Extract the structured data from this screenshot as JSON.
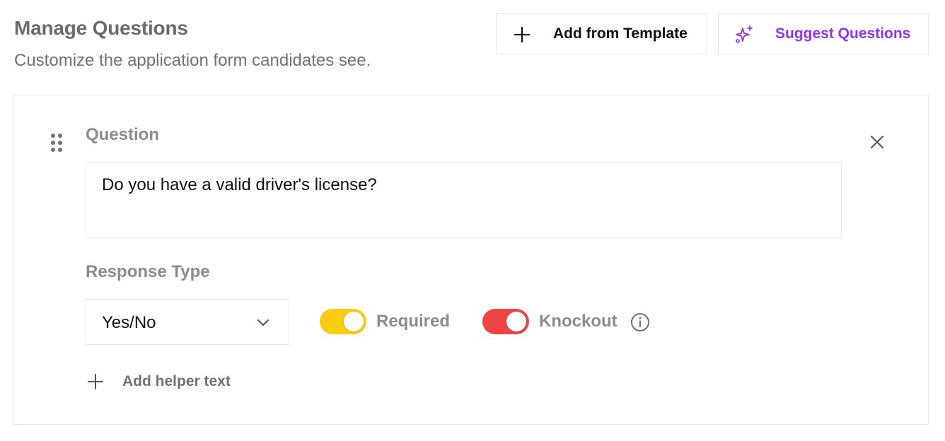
{
  "header": {
    "title": "Manage Questions",
    "subtitle": "Customize the application form candidates see."
  },
  "actions": {
    "add_from_template": {
      "label": "Add from Template",
      "icon": "plus-icon"
    },
    "suggest_questions": {
      "label": "Suggest Questions",
      "icon": "sparkles-icon",
      "color": "#9333ea"
    }
  },
  "question_card": {
    "drag_icon": "drag-handle-icon",
    "close_icon": "close-icon",
    "question_label": "Question",
    "question_value": "Do you have a valid driver's license?",
    "response_type_label": "Response Type",
    "response_type_value": "Yes/No",
    "required": {
      "label": "Required",
      "on": true,
      "color": "#facc15"
    },
    "knockout": {
      "label": "Knockout",
      "on": true,
      "color": "#ef4444",
      "info_icon": "info-icon"
    },
    "add_helper_text_label": "Add helper text"
  }
}
